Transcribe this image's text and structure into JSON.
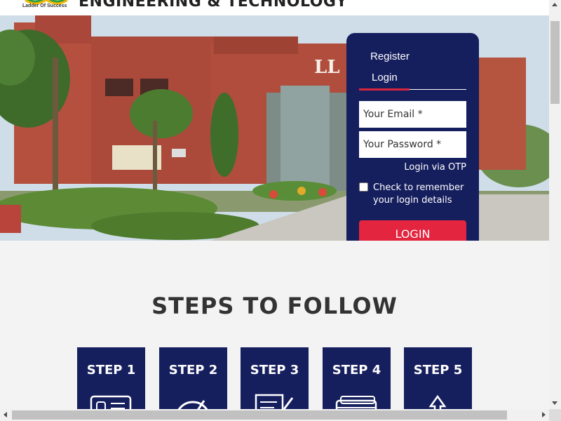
{
  "header": {
    "logo_tagline": "Ladder Of Success",
    "college_name": "ENGINEERING & TECHNOLOGY"
  },
  "hero": {
    "building_sign": "LL"
  },
  "login_panel": {
    "tab_register": "Register",
    "tab_login": "Login",
    "email_placeholder": "Your Email *",
    "password_placeholder": "Your Password *",
    "otp_link": "Login via OTP",
    "remember_text": "Check to remember your login details",
    "remember_checked": false,
    "login_button": "LOGIN"
  },
  "steps": {
    "title": "STEPS TO FOLLOW",
    "items": [
      {
        "label": "STEP 1",
        "icon": "form-icon"
      },
      {
        "label": "STEP 2",
        "icon": "gauge-icon"
      },
      {
        "label": "STEP 3",
        "icon": "document-edit-icon"
      },
      {
        "label": "STEP 4",
        "icon": "payment-card-icon"
      },
      {
        "label": "STEP 5",
        "icon": "upload-icon"
      }
    ]
  },
  "colors": {
    "navy": "#161f5e",
    "accent_red": "#e3253f",
    "background": "#f3f3f3"
  }
}
